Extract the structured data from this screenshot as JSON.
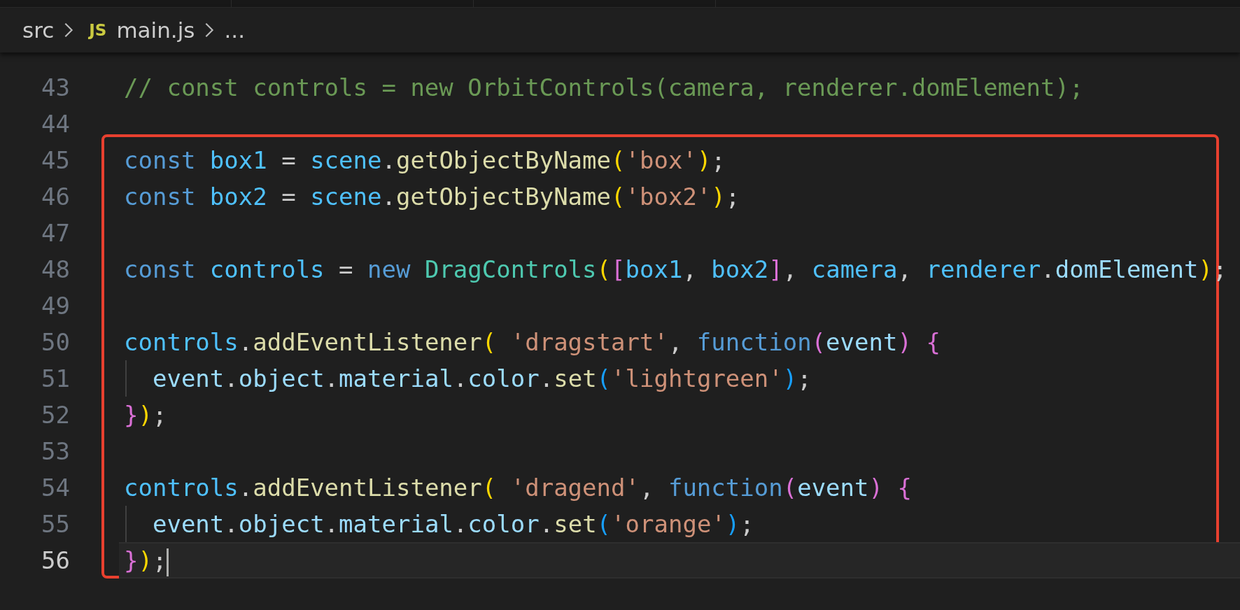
{
  "breadcrumb": {
    "items": [
      {
        "kind": "folder",
        "text": "src"
      },
      {
        "kind": "file",
        "icon_text": "JS",
        "text": "main.js"
      },
      {
        "kind": "more",
        "text": "..."
      }
    ]
  },
  "editor": {
    "lines": [
      {
        "number": "43",
        "active": false,
        "guide": false,
        "tokens": [
          {
            "kind": "cmt",
            "text": "// const controls = new OrbitControls(camera, renderer.domElement);"
          }
        ]
      },
      {
        "number": "44",
        "active": false,
        "guide": false
      }
    ],
    "framed_lines": [
      {
        "number": "45",
        "active": false,
        "guide": false,
        "tokens": [
          {
            "kind": "kw",
            "text": "const"
          },
          {
            "kind": "const",
            "text": " box1"
          },
          {
            "kind": "punc",
            "text": " = "
          },
          {
            "kind": "const",
            "text": "scene"
          },
          {
            "kind": "punc",
            "text": "."
          },
          {
            "kind": "fn",
            "text": "getObjectByName"
          },
          {
            "kind": "b1",
            "text": "("
          },
          {
            "kind": "str",
            "text": "'box'"
          },
          {
            "kind": "b1",
            "text": ")"
          },
          {
            "kind": "punc",
            "text": ";"
          }
        ]
      },
      {
        "number": "46",
        "active": false,
        "guide": false,
        "tokens": [
          {
            "kind": "kw",
            "text": "const"
          },
          {
            "kind": "const",
            "text": " box2"
          },
          {
            "kind": "punc",
            "text": " = "
          },
          {
            "kind": "const",
            "text": "scene"
          },
          {
            "kind": "punc",
            "text": "."
          },
          {
            "kind": "fn",
            "text": "getObjectByName"
          },
          {
            "kind": "b1",
            "text": "("
          },
          {
            "kind": "str",
            "text": "'box2'"
          },
          {
            "kind": "b1",
            "text": ")"
          },
          {
            "kind": "punc",
            "text": ";"
          }
        ]
      },
      {
        "number": "47",
        "active": false,
        "guide": false
      },
      {
        "number": "48",
        "active": false,
        "guide": false,
        "tokens": [
          {
            "kind": "kw",
            "text": "const"
          },
          {
            "kind": "const",
            "text": " controls"
          },
          {
            "kind": "punc",
            "text": " = "
          },
          {
            "kind": "kw",
            "text": "new"
          },
          {
            "kind": "cls",
            "text": " DragControls"
          },
          {
            "kind": "b1",
            "text": "("
          },
          {
            "kind": "b2",
            "text": "["
          },
          {
            "kind": "const",
            "text": "box1"
          },
          {
            "kind": "punc",
            "text": ", "
          },
          {
            "kind": "const",
            "text": "box2"
          },
          {
            "kind": "b2",
            "text": "]"
          },
          {
            "kind": "punc",
            "text": ", "
          },
          {
            "kind": "const",
            "text": "camera"
          },
          {
            "kind": "punc",
            "text": ", "
          },
          {
            "kind": "const",
            "text": "renderer"
          },
          {
            "kind": "punc",
            "text": "."
          },
          {
            "kind": "var",
            "text": "domElement"
          },
          {
            "kind": "b1",
            "text": ")"
          },
          {
            "kind": "punc",
            "text": ";"
          }
        ]
      },
      {
        "number": "49",
        "active": false,
        "guide": false
      },
      {
        "number": "50",
        "active": false,
        "guide": false,
        "tokens": [
          {
            "kind": "const",
            "text": "controls"
          },
          {
            "kind": "punc",
            "text": "."
          },
          {
            "kind": "fn",
            "text": "addEventListener"
          },
          {
            "kind": "b1",
            "text": "("
          },
          {
            "kind": "str",
            "text": " 'dragstart'"
          },
          {
            "kind": "punc",
            "text": ", "
          },
          {
            "kind": "kw",
            "text": "function"
          },
          {
            "kind": "b2",
            "text": "("
          },
          {
            "kind": "var",
            "text": "event"
          },
          {
            "kind": "b2",
            "text": ")"
          },
          {
            "kind": "b2",
            "text": " {"
          }
        ]
      },
      {
        "number": "51",
        "active": false,
        "guide": true,
        "tokens": [
          {
            "kind": "var",
            "text": "  event"
          },
          {
            "kind": "punc",
            "text": "."
          },
          {
            "kind": "var",
            "text": "object"
          },
          {
            "kind": "punc",
            "text": "."
          },
          {
            "kind": "var",
            "text": "material"
          },
          {
            "kind": "punc",
            "text": "."
          },
          {
            "kind": "var",
            "text": "color"
          },
          {
            "kind": "punc",
            "text": "."
          },
          {
            "kind": "fn",
            "text": "set"
          },
          {
            "kind": "b3",
            "text": "("
          },
          {
            "kind": "str",
            "text": "'lightgreen'"
          },
          {
            "kind": "b3",
            "text": ")"
          },
          {
            "kind": "punc",
            "text": ";"
          }
        ]
      },
      {
        "number": "52",
        "active": false,
        "guide": false,
        "tokens": [
          {
            "kind": "b2",
            "text": "}"
          },
          {
            "kind": "b1",
            "text": ")"
          },
          {
            "kind": "punc",
            "text": ";"
          }
        ]
      },
      {
        "number": "53",
        "active": false,
        "guide": false
      },
      {
        "number": "54",
        "active": false,
        "guide": false,
        "tokens": [
          {
            "kind": "const",
            "text": "controls"
          },
          {
            "kind": "punc",
            "text": "."
          },
          {
            "kind": "fn",
            "text": "addEventListener"
          },
          {
            "kind": "b1",
            "text": "("
          },
          {
            "kind": "str",
            "text": " 'dragend'"
          },
          {
            "kind": "punc",
            "text": ", "
          },
          {
            "kind": "kw",
            "text": "function"
          },
          {
            "kind": "b2",
            "text": "("
          },
          {
            "kind": "var",
            "text": "event"
          },
          {
            "kind": "b2",
            "text": ")"
          },
          {
            "kind": "b2",
            "text": " {"
          }
        ]
      },
      {
        "number": "55",
        "active": false,
        "guide": true,
        "tokens": [
          {
            "kind": "var",
            "text": "  event"
          },
          {
            "kind": "punc",
            "text": "."
          },
          {
            "kind": "var",
            "text": "object"
          },
          {
            "kind": "punc",
            "text": "."
          },
          {
            "kind": "var",
            "text": "material"
          },
          {
            "kind": "punc",
            "text": "."
          },
          {
            "kind": "var",
            "text": "color"
          },
          {
            "kind": "punc",
            "text": "."
          },
          {
            "kind": "fn",
            "text": "set"
          },
          {
            "kind": "b3",
            "text": "("
          },
          {
            "kind": "str",
            "text": "'orange'"
          },
          {
            "kind": "b3",
            "text": ")"
          },
          {
            "kind": "punc",
            "text": ";"
          }
        ]
      },
      {
        "number": "56",
        "active": true,
        "guide": false,
        "tokens": [
          {
            "kind": "b2",
            "text": "}"
          },
          {
            "kind": "b1",
            "text": ")"
          },
          {
            "kind": "punc",
            "text": ";"
          }
        ]
      }
    ]
  }
}
